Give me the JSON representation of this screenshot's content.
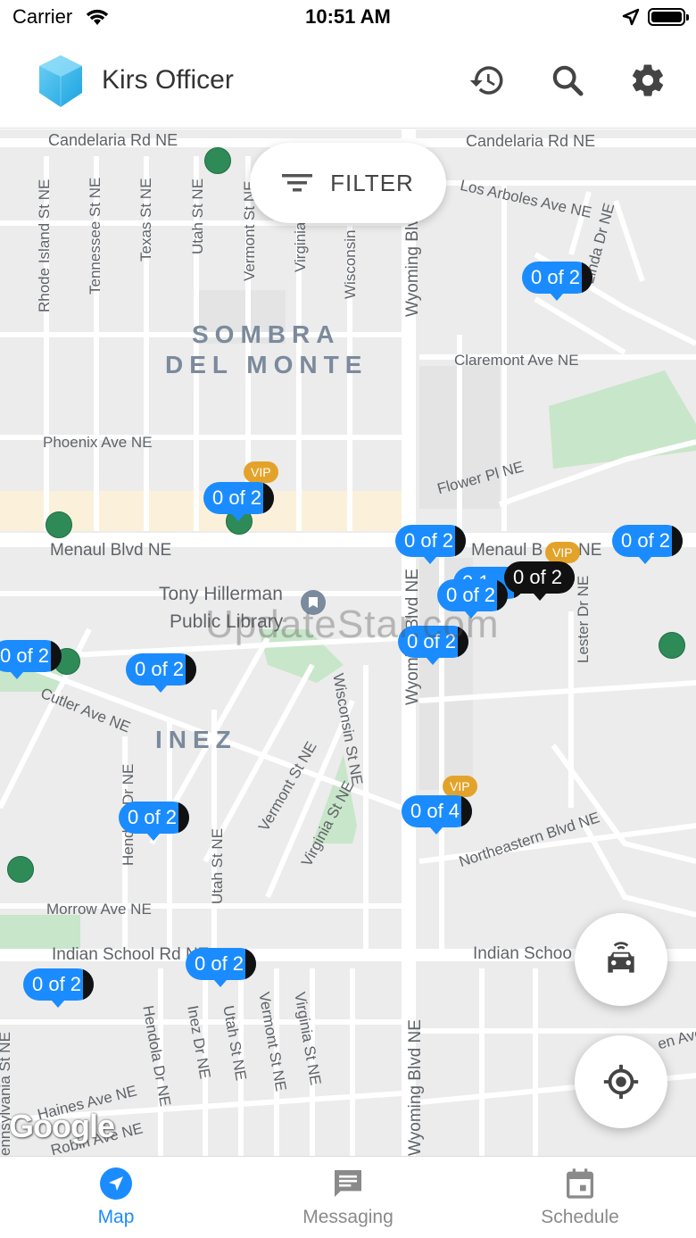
{
  "status_bar": {
    "carrier": "Carrier",
    "time": "10:51 AM"
  },
  "header": {
    "title": "Kirs Officer",
    "icons": [
      "history-icon",
      "search-icon",
      "settings-icon"
    ]
  },
  "map": {
    "filter_label": "FILTER",
    "streets": [
      "Candelaria Rd NE",
      "Candelaria Rd NE",
      "Los Arboles Ave NE",
      "Claremont Ave NE",
      "Phoenix Ave NE",
      "Flower Pl NE",
      "Menaul Blvd NE",
      "Menaul B",
      "NE",
      "Cutler Ave NE",
      "Northeastern Blvd NE",
      "Morrow Ave NE",
      "Indian School Rd NE",
      "Indian Schoo",
      "en Ave",
      "Haines Ave NE",
      "Robin Ave NE",
      "Rhode Island St NE",
      "Tennessee St NE",
      "Texas St NE",
      "Utah St NE",
      "Vermont St NE",
      "Virginia",
      "Wisconsin",
      "Wyoming Blvd",
      "Linda Dr NE",
      "Wyoming Blvd NE",
      "Lester Dr NE",
      "Wisconsin St NE",
      "Vermont St NE",
      "Virginia St NE",
      "Hendola Dr NE",
      "Utah St NE",
      "Wyoming Blvd NE",
      "Hendola Dr NE",
      "Inez Dr NE",
      "Utah St NE",
      "Vermont St NE",
      "Virginia St NE",
      "ennsylvania St NE"
    ],
    "areas": [
      "SOMBRA",
      "DEL MONTE",
      "INEZ"
    ],
    "poi": {
      "name_line1": "Tony Hillerman",
      "name_line2": "Public Library"
    },
    "watermark": "UpdateStar.com",
    "attribution": "Google",
    "pins": [
      {
        "text": "0 of 2"
      },
      {
        "text": "0 of 2",
        "vip": "VIP"
      },
      {
        "text": "0 of 2"
      },
      {
        "text": "0 of 2"
      },
      {
        "text": "0 of 2"
      },
      {
        "text": "0 of 2"
      },
      {
        "text": "0 of 2"
      },
      {
        "text": "0 of 2"
      },
      {
        "text": "0 of 2"
      },
      {
        "text": "0 of 4",
        "vip": "VIP"
      },
      {
        "text": "0 of 2"
      },
      {
        "text": "0 of 2"
      },
      {
        "text": "0 of 2"
      },
      {
        "text": "0 of 2",
        "vip": "VIP"
      },
      {
        "text": "0 1"
      }
    ],
    "fabs": [
      "car-icon",
      "my-location-icon"
    ]
  },
  "bottom_nav": {
    "items": [
      {
        "label": "Map",
        "icon": "navigation-icon",
        "active": true
      },
      {
        "label": "Messaging",
        "icon": "message-icon",
        "active": false
      },
      {
        "label": "Schedule",
        "icon": "calendar-icon",
        "active": false
      }
    ]
  },
  "colors": {
    "accent": "#1a8cff",
    "vip": "#e3a32a",
    "dot": "#2e8b57",
    "park": "#c8e6c9"
  }
}
